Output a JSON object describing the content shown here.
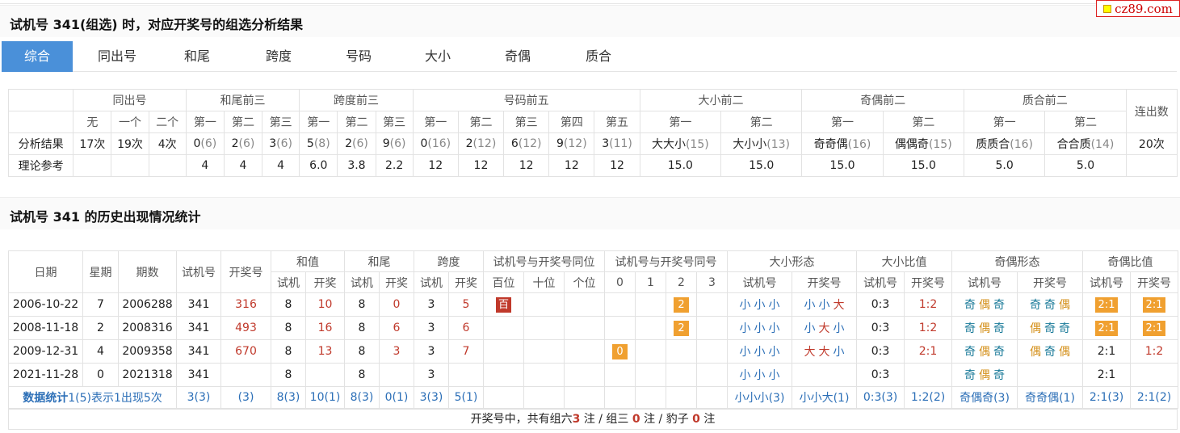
{
  "logo_text": "cz89.com",
  "section1_title": "试机号 341(组选) 时，对应开奖号的组选分析结果",
  "tabs": [
    "综合",
    "同出号",
    "和尾",
    "跨度",
    "号码",
    "大小",
    "奇偶",
    "质合"
  ],
  "t1": {
    "groups": [
      "同出号",
      "和尾前三",
      "跨度前三",
      "号码前五",
      "大小前二",
      "奇偶前二",
      "质合前二",
      "连出数"
    ],
    "subs": [
      "无",
      "一个",
      "二个",
      "第一",
      "第二",
      "第三",
      "第一",
      "第二",
      "第三",
      "第一",
      "第二",
      "第三",
      "第四",
      "第五",
      "第一",
      "第二",
      "第一",
      "第二",
      "第一",
      "第二"
    ],
    "row1_label": "分析结果",
    "row1": [
      [
        "17次",
        ""
      ],
      [
        "19次",
        ""
      ],
      [
        "4次",
        ""
      ],
      [
        "0",
        "(6)"
      ],
      [
        "2",
        "(6)"
      ],
      [
        "3",
        "(6)"
      ],
      [
        "5",
        "(8)"
      ],
      [
        "2",
        "(6)"
      ],
      [
        "9",
        "(6)"
      ],
      [
        "0",
        "(16)"
      ],
      [
        "2",
        "(12)"
      ],
      [
        "6",
        "(12)"
      ],
      [
        "9",
        "(12)"
      ],
      [
        "3",
        "(11)"
      ],
      [
        "大大小",
        "(15)"
      ],
      [
        "大小小",
        "(13)"
      ],
      [
        "奇奇偶",
        "(16)"
      ],
      [
        "偶偶奇",
        "(15)"
      ],
      [
        "质质合",
        "(16)"
      ],
      [
        "合合质",
        "(14)"
      ],
      [
        "20次",
        ""
      ]
    ],
    "row2_label": "理论参考",
    "row2": [
      "",
      "",
      "",
      "4",
      "4",
      "4",
      "6.0",
      "3.8",
      "2.2",
      "12",
      "12",
      "12",
      "12",
      "12",
      "15.0",
      "15.0",
      "15.0",
      "15.0",
      "5.0",
      "5.0",
      ""
    ]
  },
  "section2_title": "试机号 341 的历史出现情况统计",
  "t2": {
    "head_single": [
      "日期",
      "星期",
      "期数",
      "试机号",
      "开奖号"
    ],
    "head_groups": [
      "和值",
      "和尾",
      "跨度",
      "试机号与开奖号同位",
      "试机号与开奖号同号",
      "大小形态",
      "大小比值",
      "奇偶形态",
      "奇偶比值"
    ],
    "head_subs": [
      "试机",
      "开奖",
      "试机",
      "开奖",
      "试机",
      "开奖",
      "百位",
      "十位",
      "个位",
      "0",
      "1",
      "2",
      "3",
      "试机号",
      "开奖号",
      "试机号",
      "开奖号",
      "试机号",
      "开奖号",
      "试机号",
      "开奖号"
    ],
    "rows": [
      {
        "date": "2006-10-22",
        "week": "7",
        "issue": "2006288",
        "sjh": "341",
        "kjh": "316",
        "hz_s": "8",
        "hz_k": "10",
        "hw_s": "8",
        "hw_k": "0",
        "kd_s": "3",
        "kd_k": "5",
        "tw": [
          "百",
          "",
          ""
        ],
        "th": [
          "",
          "",
          "2",
          ""
        ],
        "dx_s": [
          "小",
          "小",
          "小"
        ],
        "dx_k": [
          "小",
          "小",
          "大"
        ],
        "dxb_s": "0:3",
        "dxb_k": "1:2",
        "jo_s": [
          "奇",
          "偶",
          "奇"
        ],
        "jo_k": [
          "奇",
          "奇",
          "偶"
        ],
        "job_s": "2:1",
        "job_k": "2:1"
      },
      {
        "date": "2008-11-18",
        "week": "2",
        "issue": "2008316",
        "sjh": "341",
        "kjh": "493",
        "hz_s": "8",
        "hz_k": "16",
        "hw_s": "8",
        "hw_k": "6",
        "kd_s": "3",
        "kd_k": "6",
        "tw": [
          "",
          "",
          ""
        ],
        "th": [
          "",
          "",
          "2",
          ""
        ],
        "dx_s": [
          "小",
          "小",
          "小"
        ],
        "dx_k": [
          "小",
          "大",
          "小"
        ],
        "dxb_s": "0:3",
        "dxb_k": "1:2",
        "jo_s": [
          "奇",
          "偶",
          "奇"
        ],
        "jo_k": [
          "偶",
          "奇",
          "奇"
        ],
        "job_s": "2:1",
        "job_k": "2:1"
      },
      {
        "date": "2009-12-31",
        "week": "4",
        "issue": "2009358",
        "sjh": "341",
        "kjh": "670",
        "hz_s": "8",
        "hz_k": "13",
        "hw_s": "8",
        "hw_k": "3",
        "kd_s": "3",
        "kd_k": "7",
        "tw": [
          "",
          "",
          ""
        ],
        "th": [
          "0",
          "",
          "",
          ""
        ],
        "dx_s": [
          "小",
          "小",
          "小"
        ],
        "dx_k": [
          "大",
          "大",
          "小"
        ],
        "dxb_s": "0:3",
        "dxb_k": "2:1",
        "jo_s": [
          "奇",
          "偶",
          "奇"
        ],
        "jo_k": [
          "偶",
          "奇",
          "偶"
        ],
        "job_s": "2:1",
        "job_k": "1:2"
      },
      {
        "date": "2021-11-28",
        "week": "0",
        "issue": "2021318",
        "sjh": "341",
        "kjh": "",
        "hz_s": "8",
        "hz_k": "",
        "hw_s": "8",
        "hw_k": "",
        "kd_s": "3",
        "kd_k": "",
        "tw": [
          "",
          "",
          ""
        ],
        "th": [
          "",
          "",
          "",
          ""
        ],
        "dx_s": [
          "小",
          "小",
          "小"
        ],
        "dx_k": [
          "",
          "",
          ""
        ],
        "dxb_s": "0:3",
        "dxb_k": "",
        "jo_s": [
          "奇",
          "偶",
          "奇"
        ],
        "jo_k": [
          "",
          "",
          ""
        ],
        "job_s": "2:1",
        "job_k": ""
      }
    ],
    "sum_label": "数据统计",
    "sum_note": "1(5)表示1出现5次",
    "sum": [
      "3(3)",
      "(3)",
      "8(3)",
      "10(1)",
      "8(3)",
      "0(1)",
      "3(3)",
      "5(1)",
      "",
      "",
      "",
      "",
      "",
      "",
      "",
      "小小小(3)",
      "小小大(1)",
      "0:3(3)",
      "1:2(2)",
      "奇偶奇(3)",
      "奇奇偶(1)",
      "2:1(3)",
      "2:1(2)"
    ],
    "footer": {
      "p1": "开奖号中，共有组六",
      "n1": "3",
      "p2": "注 / 组三",
      "n2": "0",
      "p3": "注 / 豹子",
      "n3": "0",
      "p4": "注"
    }
  }
}
